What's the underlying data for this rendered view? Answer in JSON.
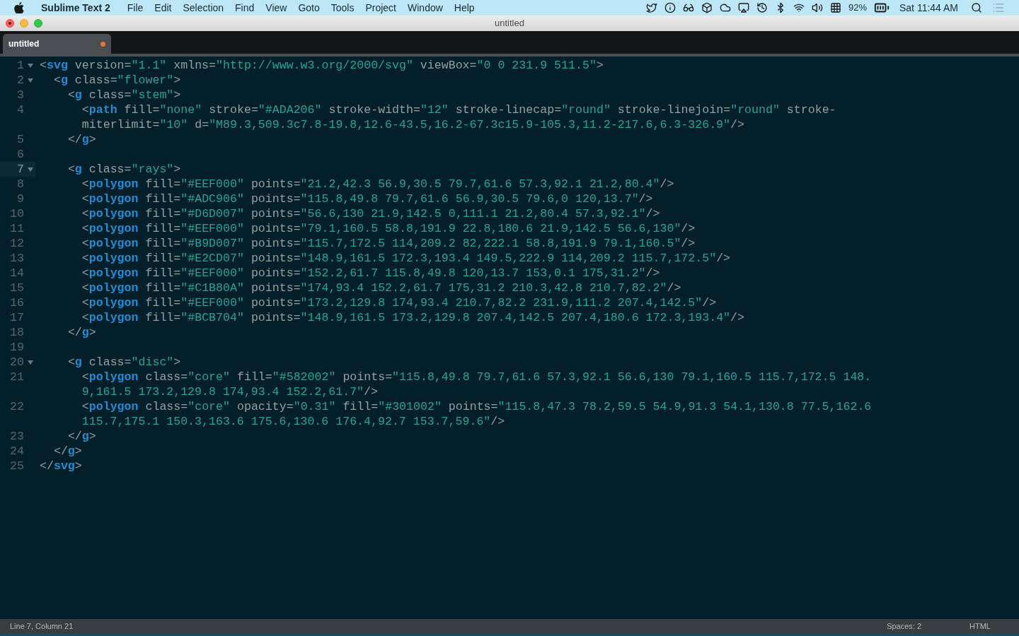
{
  "menu_bar": {
    "app_name": "Sublime Text 2",
    "menus": [
      "File",
      "Edit",
      "Selection",
      "Find",
      "View",
      "Goto",
      "Tools",
      "Project",
      "Window",
      "Help"
    ],
    "battery": "92%",
    "clock": "Sat 11:44 AM"
  },
  "window": {
    "title": "untitled"
  },
  "tabs": [
    {
      "label": "untitled",
      "selected": true,
      "modified": true
    }
  ],
  "editor": {
    "lines": [
      {
        "number": "1",
        "foldable": true,
        "current": false,
        "rows": [
          "<svg version=\"1.1\" xmlns=\"http://www.w3.org/2000/svg\" viewBox=\"0 0 231.9 511.5\">"
        ]
      },
      {
        "number": "2",
        "foldable": true,
        "current": false,
        "rows": [
          "  <g class=\"flower\">"
        ]
      },
      {
        "number": "3",
        "foldable": false,
        "current": false,
        "rows": [
          "    <g class=\"stem\">"
        ]
      },
      {
        "number": "4",
        "foldable": false,
        "current": false,
        "rows": [
          "      <path fill=\"none\" stroke=\"#ADA206\" stroke-width=\"12\" stroke-linecap=\"round\" stroke-linejoin=\"round\" stroke-",
          "      miterlimit=\"10\" d=\"M89.3,509.3c7.8-19.8,12.6-43.5,16.2-67.3c15.9-105.3,11.2-217.6,6.3-326.9\"/>"
        ]
      },
      {
        "number": "5",
        "foldable": false,
        "current": false,
        "rows": [
          "    </g>"
        ]
      },
      {
        "number": "6",
        "foldable": false,
        "current": false,
        "rows": [
          ""
        ]
      },
      {
        "number": "7",
        "foldable": true,
        "current": true,
        "rows": [
          "    <g class=\"rays\">"
        ]
      },
      {
        "number": "8",
        "foldable": false,
        "current": false,
        "rows": [
          "      <polygon fill=\"#EEF000\" points=\"21.2,42.3 56.9,30.5 79.7,61.6 57.3,92.1 21.2,80.4\"/>"
        ]
      },
      {
        "number": "9",
        "foldable": false,
        "current": false,
        "rows": [
          "      <polygon fill=\"#ADC906\" points=\"115.8,49.8 79.7,61.6 56.9,30.5 79.6,0 120,13.7\"/>"
        ]
      },
      {
        "number": "10",
        "foldable": false,
        "current": false,
        "rows": [
          "      <polygon fill=\"#D6D007\" points=\"56.6,130 21.9,142.5 0,111.1 21.2,80.4 57.3,92.1\"/>"
        ]
      },
      {
        "number": "11",
        "foldable": false,
        "current": false,
        "rows": [
          "      <polygon fill=\"#EEF000\" points=\"79.1,160.5 58.8,191.9 22.8,180.6 21.9,142.5 56.6,130\"/>"
        ]
      },
      {
        "number": "12",
        "foldable": false,
        "current": false,
        "rows": [
          "      <polygon fill=\"#B9D007\" points=\"115.7,172.5 114,209.2 82,222.1 58.8,191.9 79.1,160.5\"/>"
        ]
      },
      {
        "number": "13",
        "foldable": false,
        "current": false,
        "rows": [
          "      <polygon fill=\"#E2CD07\" points=\"148.9,161.5 172.3,193.4 149.5,222.9 114,209.2 115.7,172.5\"/>"
        ]
      },
      {
        "number": "14",
        "foldable": false,
        "current": false,
        "rows": [
          "      <polygon fill=\"#EEF000\" points=\"152.2,61.7 115.8,49.8 120,13.7 153,0.1 175,31.2\"/>"
        ]
      },
      {
        "number": "15",
        "foldable": false,
        "current": false,
        "rows": [
          "      <polygon fill=\"#C1B80A\" points=\"174,93.4 152.2,61.7 175,31.2 210.3,42.8 210.7,82.2\"/>"
        ]
      },
      {
        "number": "16",
        "foldable": false,
        "current": false,
        "rows": [
          "      <polygon fill=\"#EEF000\" points=\"173.2,129.8 174,93.4 210.7,82.2 231.9,111.2 207.4,142.5\"/>"
        ]
      },
      {
        "number": "17",
        "foldable": false,
        "current": false,
        "rows": [
          "      <polygon fill=\"#BCB704\" points=\"148.9,161.5 173.2,129.8 207.4,142.5 207.4,180.6 172.3,193.4\"/>"
        ]
      },
      {
        "number": "18",
        "foldable": false,
        "current": false,
        "rows": [
          "    </g>"
        ]
      },
      {
        "number": "19",
        "foldable": false,
        "current": false,
        "rows": [
          ""
        ]
      },
      {
        "number": "20",
        "foldable": true,
        "current": false,
        "rows": [
          "    <g class=\"disc\">"
        ]
      },
      {
        "number": "21",
        "foldable": false,
        "current": false,
        "rows": [
          "      <polygon class=\"core\" fill=\"#582002\" points=\"115.8,49.8 79.7,61.6 57.3,92.1 56.6,130 79.1,160.5 115.7,172.5 148.",
          "      9,161.5 173.2,129.8 174,93.4 152.2,61.7\"/>"
        ]
      },
      {
        "number": "22",
        "foldable": false,
        "current": false,
        "rows": [
          "      <polygon class=\"core\" opacity=\"0.31\" fill=\"#301002\" points=\"115.8,47.3 78.2,59.5 54.9,91.3 54.1,130.8 77.5,162.6",
          "      115.7,175.1 150.3,163.6 175.6,130.6 176.4,92.7 153.7,59.6\"/>"
        ]
      },
      {
        "number": "23",
        "foldable": false,
        "current": false,
        "rows": [
          "    </g>"
        ]
      },
      {
        "number": "24",
        "foldable": false,
        "current": false,
        "rows": [
          "  </g>"
        ]
      },
      {
        "number": "25",
        "foldable": false,
        "current": false,
        "rows": [
          "</svg>"
        ]
      }
    ]
  },
  "status_bar": {
    "position": "Line 7, Column 21",
    "indentation": "Spaces: 2",
    "syntax": "HTML"
  }
}
